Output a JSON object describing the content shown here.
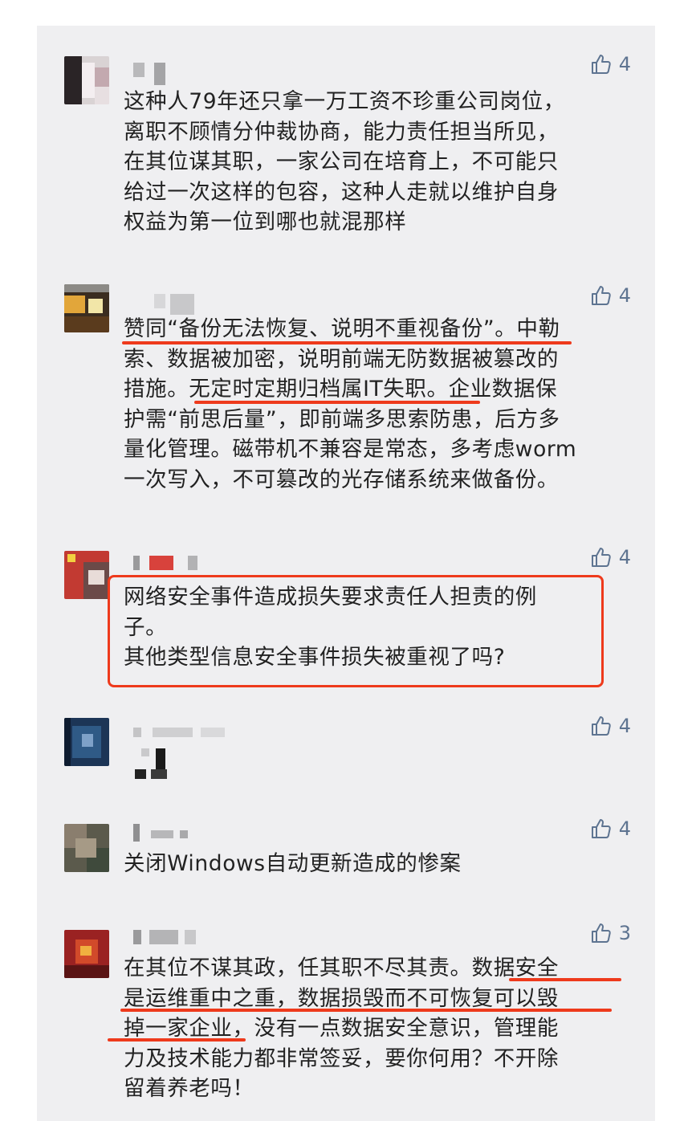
{
  "colors": {
    "accent_red": "#ee3a1c",
    "like_blue": "#5e7491",
    "panel_bg": "#efeff1"
  },
  "comments": [
    {
      "likes": "4",
      "text": "这种人79年还只拿一万工资不珍重公司岗位，\n离职不顾情分仲裁协商，能力责任担当所见，\n在其位谋其职，一家公司在培育上，不可能只\n给过一次这样的包容，这种人走就以维护自身\n权益为第一位到哪也就混那样"
    },
    {
      "likes": "4",
      "text": "赞同“备份无法恢复、说明不重视备份”。中勒\n索、数据被加密，说明前端无防数据被篡改的\n措施。无定时定期归档属IT失职。企业数据保\n护需“前思后量”，即前端多思索防患，后方多\n量化管理。磁带机不兼容是常态，多考虑worm\n一次写入，不可篡改的光存储系统来做备份。"
    },
    {
      "likes": "4",
      "text": "网络安全事件造成损失要求责任人担责的例\n子。\n其他类型信息安全事件损失被重视了吗?"
    },
    {
      "likes": "4",
      "text": ""
    },
    {
      "likes": "4",
      "text": "关闭Windows自动更新造成的惨案"
    },
    {
      "likes": "3",
      "text": "在其位不谋其政，任其职不尽其责。数据安全\n是运维重中之重，数据损毁而不可恢复可以毁\n掉一家企业，没有一点数据安全意识，管理能\n力及技术能力都非常签妥，要你何用？不开除\n留着养老吗！"
    }
  ]
}
